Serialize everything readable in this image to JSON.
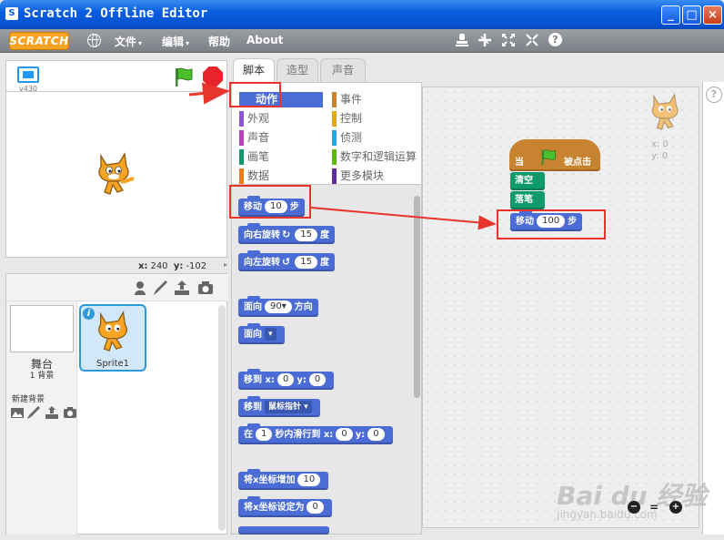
{
  "window": {
    "title": "Scratch 2 Offline Editor",
    "title_icon": "scratch-window-icon",
    "controls": {
      "minimize": "_",
      "maximize": "□",
      "close": "×"
    }
  },
  "menubar": {
    "logo": "SCRATCH",
    "items": [
      {
        "label": "文件",
        "caret": "▾"
      },
      {
        "label": "编辑",
        "caret": "▾"
      },
      {
        "label": "帮助"
      },
      {
        "label": "About"
      }
    ],
    "tool_icons": [
      "stamp-icon",
      "cut-icon",
      "grow-icon",
      "shrink-icon",
      "help-icon"
    ],
    "help_glyph": "?"
  },
  "stage": {
    "version": "v430",
    "coords": {
      "x_label": "x:",
      "x": "240",
      "y_label": "y:",
      "y": "-102"
    },
    "collapse_glyph": "▸"
  },
  "sprites": {
    "stage_label": "舞台",
    "stage_bg_count": "1 背景",
    "new_bg_label": "新建背景",
    "sprite_name": "Sprite1",
    "info_glyph": "i"
  },
  "tabs": [
    {
      "label": "脚本",
      "active": true
    },
    {
      "label": "造型",
      "active": false
    },
    {
      "label": "声音",
      "active": false
    }
  ],
  "categories": [
    {
      "label": "动作",
      "color": "#4a6cd4",
      "active": true
    },
    {
      "label": "外观",
      "color": "#8a55d7"
    },
    {
      "label": "声音",
      "color": "#bb42c3"
    },
    {
      "label": "画笔",
      "color": "#0e9a6c"
    },
    {
      "label": "数据",
      "color": "#ee7d16"
    },
    {
      "label": "事件",
      "color": "#c88330"
    },
    {
      "label": "控制",
      "color": "#e1a91a"
    },
    {
      "label": "侦测",
      "color": "#2ca5e2"
    },
    {
      "label": "数字和逻辑运算",
      "color": "#5cb712"
    },
    {
      "label": "更多模块",
      "color": "#632d99"
    }
  ],
  "palette_blocks": {
    "move": {
      "pre": "移动",
      "value": "10",
      "post": "步"
    },
    "turn_right": {
      "pre": "向右旋转",
      "icon": "↻",
      "value": "15",
      "post": "度"
    },
    "turn_left": {
      "pre": "向左旋转",
      "icon": "↺",
      "value": "15",
      "post": "度"
    },
    "point_dir": {
      "pre": "面向",
      "value": "90▾",
      "post": "方向"
    },
    "point_toward": {
      "pre": "面向",
      "value": "▾"
    },
    "goto_xy": {
      "pre": "移到 x:",
      "x": "0",
      "mid": "y:",
      "y": "0"
    },
    "goto": {
      "pre": "移到",
      "value": "鼠标指针 ▾"
    },
    "glide": {
      "pre": "在",
      "secs": "1",
      "mid": "秒内滑行到 x:",
      "x": "0",
      "mid2": "y:",
      "y": "0"
    },
    "change_x": {
      "pre": "将x坐标增加",
      "value": "10"
    },
    "set_x": {
      "pre": "将x坐标设定为",
      "value": "0"
    }
  },
  "script": {
    "hat_when": "当",
    "hat_clicked": "被点击",
    "clear": "清空",
    "pen_down": "落笔",
    "move_pre": "移动",
    "move_value": "100",
    "move_post": "步"
  },
  "sprite_preview": {
    "x_label": "x: 0",
    "y_label": "y: 0"
  },
  "zoom": {
    "out": "−",
    "reset": "=",
    "in": "+"
  },
  "right_help": "?",
  "watermark": {
    "brand": "Bai du 经验",
    "url": "jingyan.baidu.com"
  },
  "colors": {
    "motion": "#4a6cd4",
    "pen": "#0e9a6c",
    "events": "#c88330",
    "annotation": "#e8352b"
  }
}
